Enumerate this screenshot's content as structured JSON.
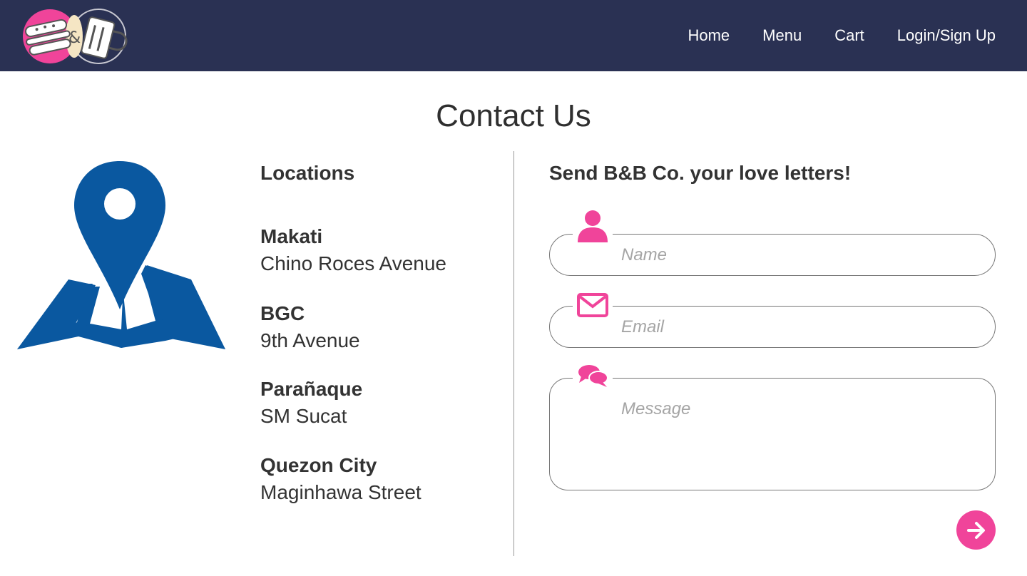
{
  "header": {
    "logo_alt": "B&B Co. logo",
    "nav": [
      "Home",
      "Menu",
      "Cart",
      "Login/Sign Up"
    ]
  },
  "page": {
    "title": "Contact Us"
  },
  "locations": {
    "heading": "Locations",
    "items": [
      {
        "name": "Makati",
        "address": "Chino Roces Avenue"
      },
      {
        "name": "BGC",
        "address": "9th Avenue"
      },
      {
        "name": "Parañaque",
        "address": "SM Sucat"
      },
      {
        "name": "Quezon City",
        "address": "Maginhawa Street"
      }
    ]
  },
  "form": {
    "heading": "Send B&B Co. your love letters!",
    "name_placeholder": "Name",
    "email_placeholder": "Email",
    "message_placeholder": "Message"
  },
  "colors": {
    "navbar": "#2a3153",
    "accent_pink": "#f0449a",
    "map_blue": "#0a58a0"
  },
  "icons": {
    "logo": "burger-and-drink-logo",
    "map": "map-pin-icon",
    "name": "person-icon",
    "email": "envelope-icon",
    "message": "chat-bubbles-icon",
    "submit": "arrow-right-icon"
  }
}
